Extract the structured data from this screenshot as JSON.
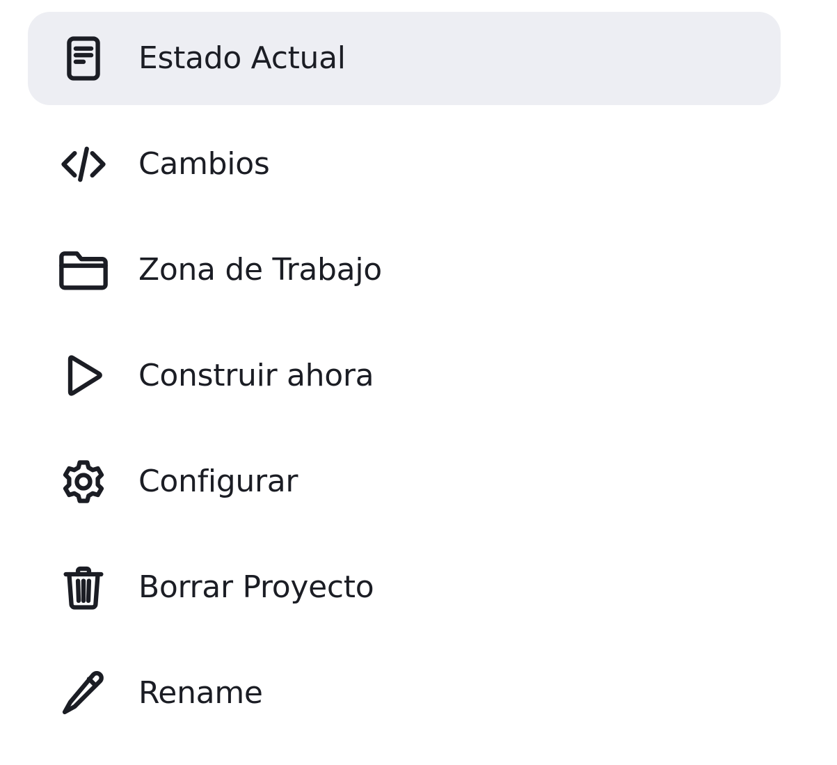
{
  "menu": {
    "items": [
      {
        "label": "Estado Actual",
        "icon": "document-icon",
        "active": true
      },
      {
        "label": "Cambios",
        "icon": "code-icon",
        "active": false
      },
      {
        "label": "Zona de Trabajo",
        "icon": "folder-icon",
        "active": false
      },
      {
        "label": "Construir ahora",
        "icon": "play-icon",
        "active": false
      },
      {
        "label": "Configurar",
        "icon": "gear-icon",
        "active": false
      },
      {
        "label": "Borrar Proyecto",
        "icon": "trash-icon",
        "active": false
      },
      {
        "label": "Rename",
        "icon": "pencil-icon",
        "active": false
      }
    ],
    "colors": {
      "active_background": "#edeef3",
      "text": "#1b1d24"
    }
  }
}
